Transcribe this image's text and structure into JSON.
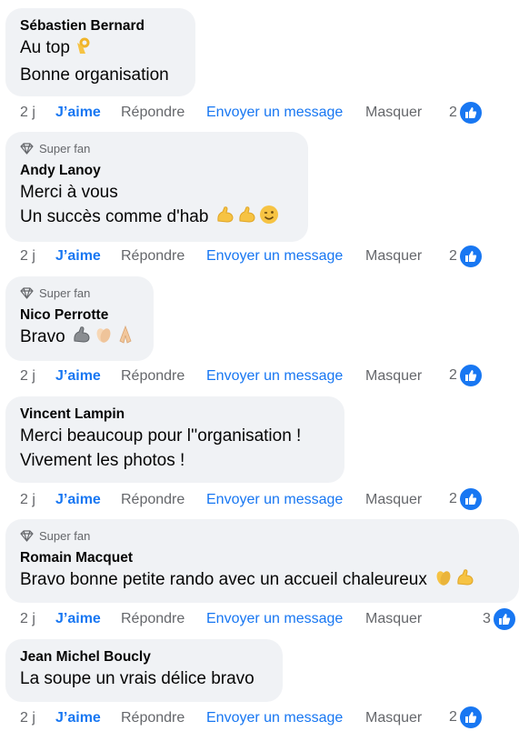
{
  "actions": {
    "time": "2 j",
    "like": "J’aime",
    "reply": "Répondre",
    "message": "Envoyer un message",
    "hide": "Masquer"
  },
  "badge_label": "Super fan",
  "comments": [
    {
      "author": "Sébastien Bernard",
      "lines": [
        "Au top",
        "Bonne organisation"
      ],
      "super_fan": false,
      "reactions": "2",
      "emojis": [
        "ok-hand"
      ]
    },
    {
      "author": "Andy Lanoy",
      "lines": [
        "Merci à vous",
        "Un succès comme d'hab"
      ],
      "super_fan": true,
      "reactions": "2",
      "emojis": [
        "flexed-biceps",
        "flexed-biceps",
        "winking-face"
      ]
    },
    {
      "author": "Nico Perrotte",
      "lines": [
        "Bravo"
      ],
      "super_fan": true,
      "reactions": "2",
      "emojis": [
        "mechanical-arm",
        "clapping-hands",
        "folded-hands"
      ]
    },
    {
      "author": "Vincent Lampin",
      "lines": [
        "Merci beaucoup pour l''organisation !",
        "Vivement les photos !"
      ],
      "super_fan": false,
      "reactions": "2",
      "emojis": []
    },
    {
      "author": "Romain Macquet",
      "lines": [
        "Bravo bonne petite rando avec un accueil chaleureux"
      ],
      "super_fan": true,
      "reactions": "3",
      "emojis": [
        "clapping-hands",
        "flexed-biceps"
      ]
    },
    {
      "author": "Jean Michel Boucly",
      "lines": [
        "La soupe un vrais délice bravo"
      ],
      "super_fan": false,
      "reactions": "2",
      "emojis": []
    }
  ],
  "colors": {
    "bubble": "#f0f2f5",
    "link": "#1877f2",
    "secondary": "#65676b"
  }
}
